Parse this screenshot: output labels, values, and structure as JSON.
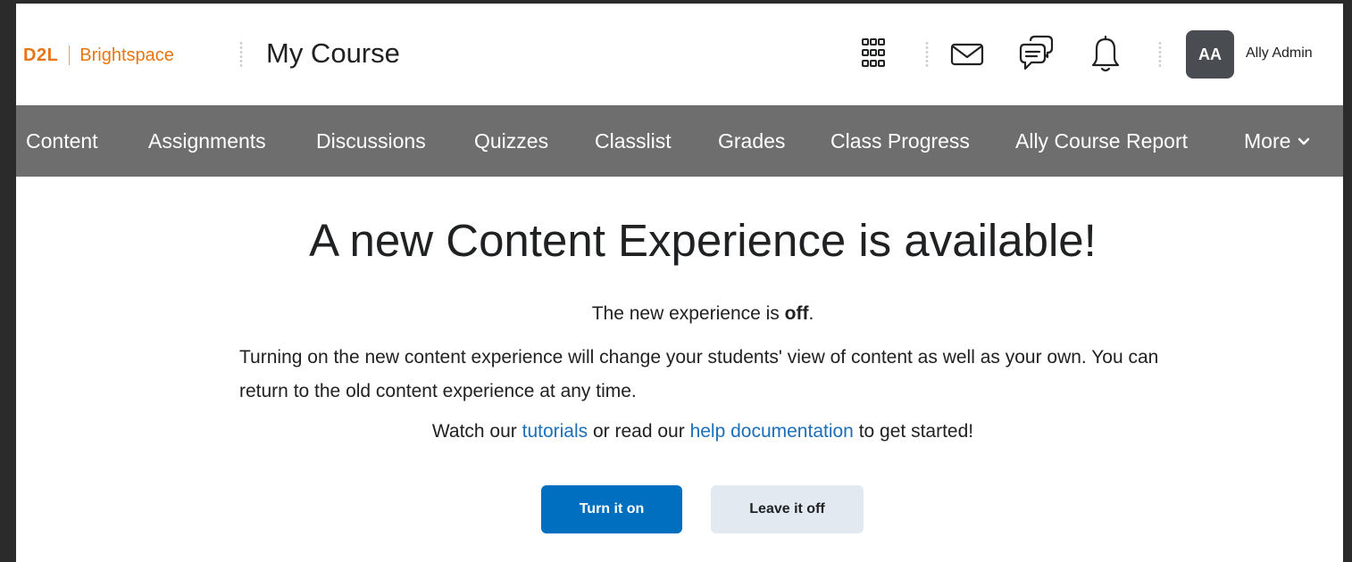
{
  "header": {
    "logo": {
      "brand": "D2L",
      "product": "Brightspace"
    },
    "course_title": "My Course",
    "icons": [
      "apps-grid-icon",
      "mail-icon",
      "chat-bubbles-icon",
      "bell-icon"
    ],
    "user": {
      "initials": "AA",
      "name": "Ally Admin"
    }
  },
  "nav": {
    "items": [
      {
        "label": "Content"
      },
      {
        "label": "Assignments"
      },
      {
        "label": "Discussions"
      },
      {
        "label": "Quizzes"
      },
      {
        "label": "Classlist"
      },
      {
        "label": "Grades"
      },
      {
        "label": "Class Progress"
      },
      {
        "label": "Ally Course Report"
      }
    ],
    "more_label": "More"
  },
  "main": {
    "headline": "A new Content Experience is available!",
    "status_prefix": "The new experience is ",
    "status_value": "off",
    "status_suffix": ".",
    "description": "Turning on the new content experience will change your students' view of content as well as your own. You can return to the old content experience at any time.",
    "watch_prefix": "Watch our ",
    "tutorials_link": "tutorials",
    "watch_middle": " or read our ",
    "help_link": "help documentation",
    "watch_suffix": " to get started!",
    "turn_on_label": "Turn it on",
    "leave_off_label": "Leave it off"
  },
  "colors": {
    "brand_orange": "#e87511",
    "navbar_bg": "#6e6e6e",
    "primary_button": "#006fbf",
    "secondary_button": "#e3e9f1",
    "link": "#1a6fb8",
    "avatar_bg": "#494c50"
  }
}
